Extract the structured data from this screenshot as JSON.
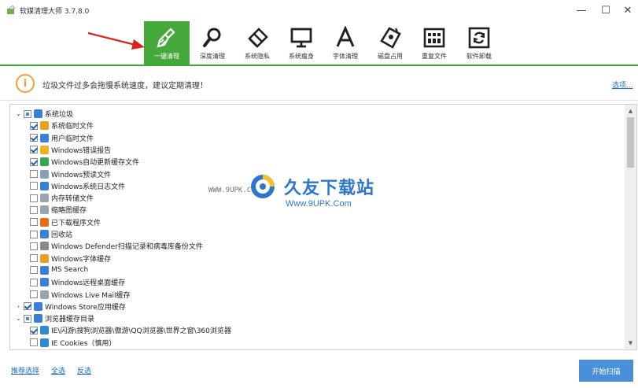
{
  "window": {
    "title": "软媒清理大师 3.7.8.0",
    "minimize_glyph": "—",
    "maximize_glyph": "☐",
    "close_glyph": "✕"
  },
  "toolbar": {
    "tools": [
      {
        "label": "一键清理",
        "icon": "broom-icon",
        "active": true
      },
      {
        "label": "深度清理",
        "icon": "magnifier-icon",
        "active": false
      },
      {
        "label": "系统隐私",
        "icon": "eraser-icon",
        "active": false
      },
      {
        "label": "系统瘦身",
        "icon": "monitor-icon",
        "active": false
      },
      {
        "label": "字体清理",
        "icon": "font-icon",
        "active": false
      },
      {
        "label": "磁盘占用",
        "icon": "disk-tag-icon",
        "active": false
      },
      {
        "label": "重复文件",
        "icon": "duplicate-grid-icon",
        "active": false
      },
      {
        "label": "软件卸载",
        "icon": "recycle-icon",
        "active": false
      }
    ],
    "accent_color": "#44a83a"
  },
  "info": {
    "icon_glyph": "i",
    "message": "垃圾文件过多会拖慢系统速度，建议定期清理！",
    "options_link": "选项..."
  },
  "tree": {
    "expander_open": "⌄",
    "expander_closed": "›",
    "items": [
      {
        "label": "系统垃圾",
        "level": 0,
        "state": "partial",
        "expander": "open",
        "icon_color": "#3a7fd6"
      },
      {
        "label": "系统临时文件",
        "level": 1,
        "state": "checked",
        "icon_color": "#e8a020"
      },
      {
        "label": "用户临时文件",
        "level": 1,
        "state": "checked",
        "icon_color": "#3a7fd6"
      },
      {
        "label": "Windows错误报告",
        "level": 1,
        "state": "checked",
        "icon_color": "#f0b020"
      },
      {
        "label": "Windows自动更新缓存文件",
        "level": 1,
        "state": "checked",
        "icon_color": "#2fa84f"
      },
      {
        "label": "Windows预读文件",
        "level": 1,
        "state": "unchecked",
        "icon_color": "#8aa0b8"
      },
      {
        "label": "Windows系统日志文件",
        "level": 1,
        "state": "unchecked",
        "icon_color": "#3a7fd6"
      },
      {
        "label": "内存转储文件",
        "level": 1,
        "state": "unchecked",
        "icon_color": "#9aa4ae"
      },
      {
        "label": "缩略图缓存",
        "level": 1,
        "state": "unchecked",
        "icon_color": "#9aa4ae"
      },
      {
        "label": "已下载程序文件",
        "level": 1,
        "state": "unchecked",
        "icon_color": "#e86a1a"
      },
      {
        "label": "回收站",
        "level": 1,
        "state": "unchecked",
        "icon_color": "#3a7fd6"
      },
      {
        "label": "Windows Defender扫描记录和病毒库备份文件",
        "level": 1,
        "state": "unchecked",
        "icon_color": "#8a8a8a"
      },
      {
        "label": "Windows字体缓存",
        "level": 1,
        "state": "unchecked",
        "icon_color": "#e8a020"
      },
      {
        "label": "MS Search",
        "level": 1,
        "state": "unchecked",
        "icon_color": "#3a7fd6"
      },
      {
        "label": "Windows远程桌面缓存",
        "level": 1,
        "state": "unchecked",
        "icon_color": "#3a7fd6"
      },
      {
        "label": "Windows Live Mail缓存",
        "level": 1,
        "state": "unchecked",
        "icon_color": "#9aa4ae"
      },
      {
        "label": "Windows Store应用缓存",
        "level": 0,
        "state": "checked",
        "expander": "closed",
        "icon_color": "#3a7fd6"
      },
      {
        "label": "浏览器缓存目录",
        "level": 0,
        "state": "partial",
        "expander": "open",
        "icon_color": "#3a7fd6"
      },
      {
        "label": "IE\\闪游\\搜狗浏览器\\傲游\\QQ浏览器\\世界之窗\\360浏览器",
        "level": 1,
        "state": "checked",
        "icon_color": "#2f8ad6"
      },
      {
        "label": "IE Cookies（慎用）",
        "level": 1,
        "state": "unchecked",
        "icon_color": "#2f8ad6"
      }
    ]
  },
  "scrollbar": {
    "up_glyph": "▲",
    "down_glyph": "▼"
  },
  "watermark": {
    "url_left": "WWW.9UPK.COM",
    "brand": "久友下载站",
    "url_right": "Www.9UPK.Com"
  },
  "footer": {
    "recommend": "推荐选择",
    "select_all": "全选",
    "invert": "反选",
    "start_scan": "开始扫描"
  }
}
